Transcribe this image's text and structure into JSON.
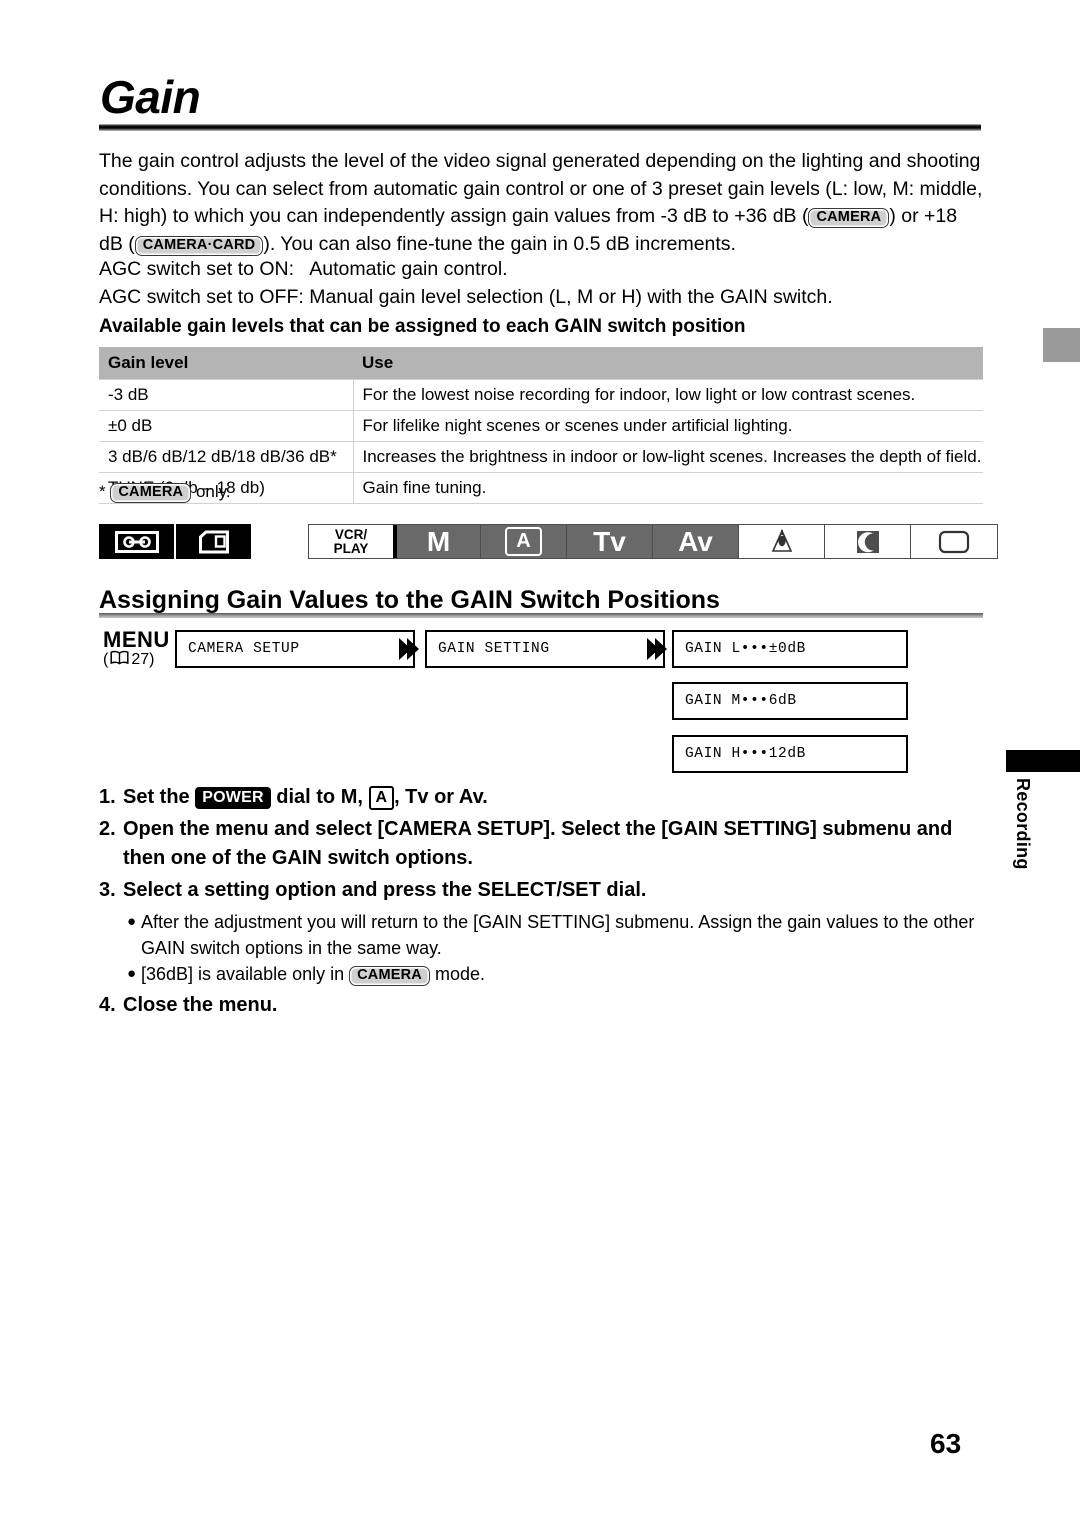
{
  "page": {
    "title": "Gain",
    "page_number": "63"
  },
  "intro": {
    "part1": "The gain control adjusts the level of the video signal generated depending on the lighting and shooting conditions. You can select from automatic gain control or one of 3 preset gain levels (L: low, M: middle, H: high) to which you can independently assign gain values from -3 dB to +36 dB (",
    "badge_camera": "CAMERA",
    "part2": ") or +18 dB (",
    "badge_camera_card": "CAMERA·CARD",
    "part3": "). You can also fine-tune the gain in 0.5 dB increments.",
    "agc_on": "AGC switch set to ON:   Automatic gain control.",
    "agc_off": "AGC switch set to OFF: Manual gain level selection (L, M or H) with the GAIN switch."
  },
  "table": {
    "heading": "Available gain levels that can be assigned to each GAIN switch position",
    "columns": [
      "Gain level",
      "Use"
    ],
    "rows": [
      [
        "-3 dB",
        "For the lowest noise recording for indoor, low light or low contrast scenes."
      ],
      [
        "±0 dB",
        "For lifelike night scenes or scenes under artificial lighting."
      ],
      [
        "3 dB/6 dB/12 dB/18 dB/36 dB*",
        "Increases the brightness in indoor or low-light scenes. Increases the depth of field."
      ],
      [
        "TUNE (0 db – 18 db)",
        "Gain fine tuning."
      ]
    ],
    "footnote_prefix": "*",
    "footnote_badge": "CAMERA",
    "footnote_suffix": "only."
  },
  "media_icons": [
    {
      "name": "tape-icon"
    },
    {
      "name": "card-icon"
    }
  ],
  "mode_bar": {
    "cells": [
      {
        "label": "VCR/\nPLAY",
        "name": "mode-vcr-play",
        "active": false
      },
      {
        "label": "M",
        "name": "mode-m",
        "active": true
      },
      {
        "label": "A",
        "name": "mode-a",
        "active": true
      },
      {
        "label": "Tv",
        "name": "mode-tv",
        "active": true
      },
      {
        "label": "Av",
        "name": "mode-av",
        "active": true
      },
      {
        "label": "",
        "name": "mode-spotlight",
        "active": false
      },
      {
        "label": "",
        "name": "mode-night",
        "active": false
      },
      {
        "label": "",
        "name": "mode-easy",
        "active": false
      }
    ],
    "vcr_line1": "VCR/",
    "vcr_line2": "PLAY"
  },
  "section": {
    "heading": "Assigning Gain Values to the GAIN Switch Positions",
    "menu_label": "MENU",
    "menu_ref_open": "(",
    "menu_ref_page": "27)",
    "boxes": [
      "CAMERA SETUP",
      "GAIN SETTING",
      "GAIN L•••±0dB",
      "GAIN M•••6dB",
      "GAIN H•••12dB"
    ]
  },
  "steps": [
    {
      "num": "1.",
      "text_a": "Set the",
      "badge_power": "POWER",
      "text_b": "dial to M,",
      "badge_a": "A",
      "text_c": ", Tv or Av."
    },
    {
      "num": "2.",
      "text": "Open the menu and select [CAMERA SETUP]. Select the [GAIN SETTING] submenu and then one of the GAIN switch options."
    },
    {
      "num": "3.",
      "text": "Select a setting option and press the SELECT/SET dial."
    },
    {
      "num": "4.",
      "text": "Close the menu."
    }
  ],
  "bullets": [
    {
      "text": "After the adjustment you will return to the [GAIN SETTING] submenu. Assign the gain values to the other GAIN switch options in the same way."
    },
    {
      "text_a": "[36dB] is available only in",
      "badge": "CAMERA",
      "text_b": "mode."
    }
  ],
  "side_tab": {
    "label": "Recording"
  },
  "colors": {
    "header_gray": "#b4b4b4",
    "mode_active_gray": "#696969",
    "tab_gray": "#9a9a9a",
    "badge_gray": "#cfcfcf"
  }
}
